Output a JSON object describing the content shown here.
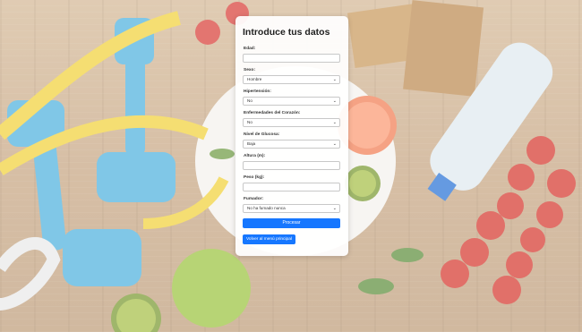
{
  "form": {
    "title": "Introduce tus datos",
    "edad": {
      "label": "Edad:",
      "value": ""
    },
    "sexo": {
      "label": "Sexo:",
      "value": "Hombre"
    },
    "hipertension": {
      "label": "Hipertensión:",
      "value": "No"
    },
    "corazon": {
      "label": "Enfermedades del Corazón:",
      "value": "No"
    },
    "glucosa": {
      "label": "Nivel de Glucosa:",
      "value": "Baja"
    },
    "altura": {
      "label": "Altura (m):",
      "value": ""
    },
    "peso": {
      "label": "Peso (kg):",
      "value": ""
    },
    "fumador": {
      "label": "Fumador:",
      "value": "No ha fumado nunca"
    },
    "procesar": "Procesar",
    "volver": "Volver al menú principal"
  },
  "colors": {
    "accent": "#1677ff"
  },
  "icons": {
    "select": "chevron-down-icon"
  }
}
